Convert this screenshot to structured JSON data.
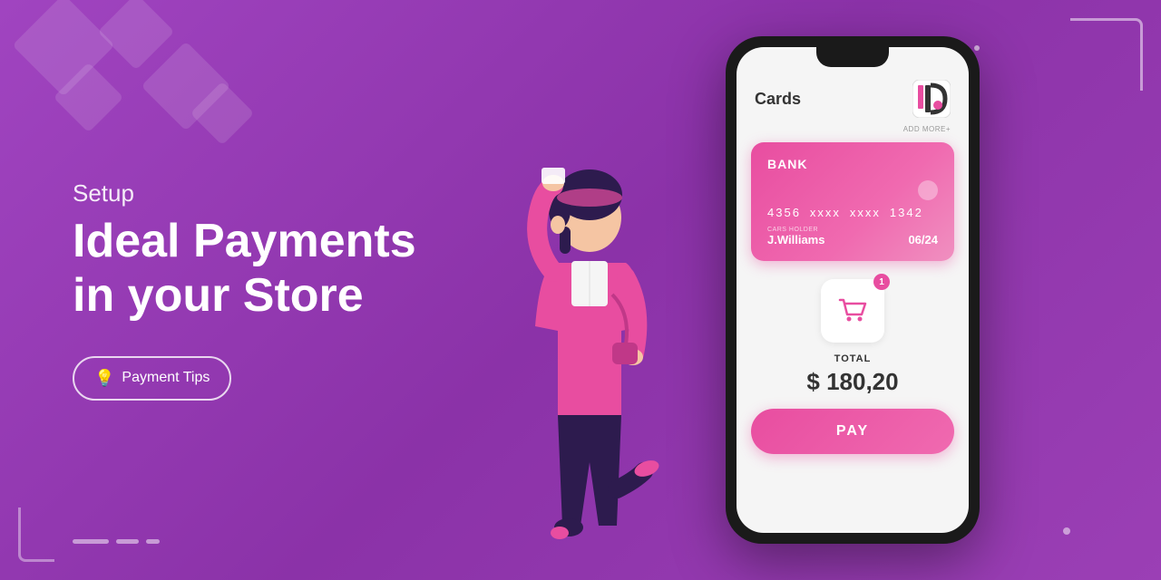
{
  "background": {
    "color": "#9b3fb5"
  },
  "left": {
    "subtitle": "Setup",
    "main_title_line1": "Ideal Payments",
    "main_title_line2": "in your Store",
    "button_label": "Payment Tips"
  },
  "phone": {
    "header": {
      "cards_title": "Cards",
      "add_more_label": "ADD MORE+"
    },
    "card": {
      "bank_label": "BANK",
      "number_parts": [
        "4356",
        "xxxx",
        "xxxx",
        "1342"
      ],
      "holder_label": "CARS HOLDER",
      "holder_name": "J.Williams",
      "expiry": "06/24"
    },
    "cart": {
      "badge_count": "1",
      "total_label": "TOTAL",
      "total_amount": "$ 180,20",
      "pay_label": "PAY"
    }
  },
  "deco": {
    "dots_count": 3,
    "dashes": [
      "long",
      "medium",
      "short"
    ]
  }
}
